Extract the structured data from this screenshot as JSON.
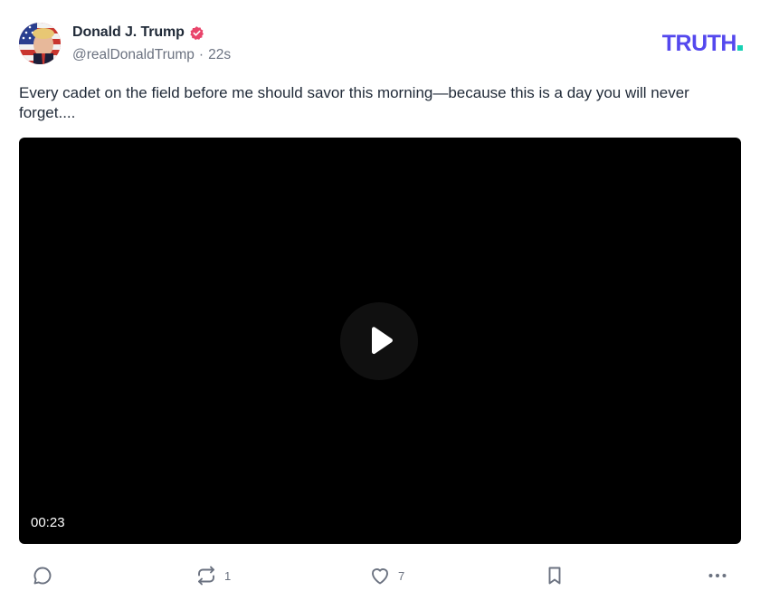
{
  "post": {
    "author_name": "Donald J. Trump",
    "handle": "@realDonaldTrump",
    "separator": "·",
    "time": "22s",
    "text": "Every cadet on the field before me should savor this morning—because this is a day you will never forget....",
    "verified": true
  },
  "brand": {
    "logo_text": "TRUTH",
    "logo_color": "#5448ee",
    "dot_color": "#17d1b4"
  },
  "video": {
    "duration": "00:23",
    "background": "#000000"
  },
  "actions": {
    "reply_count": "",
    "retruth_count": "1",
    "like_count": "7"
  },
  "icons": {
    "reply": "reply-icon",
    "retruth": "retruth-icon",
    "like": "heart-icon",
    "bookmark": "bookmark-icon",
    "more": "more-icon",
    "play": "play-icon",
    "verified": "verified-badge-icon"
  }
}
